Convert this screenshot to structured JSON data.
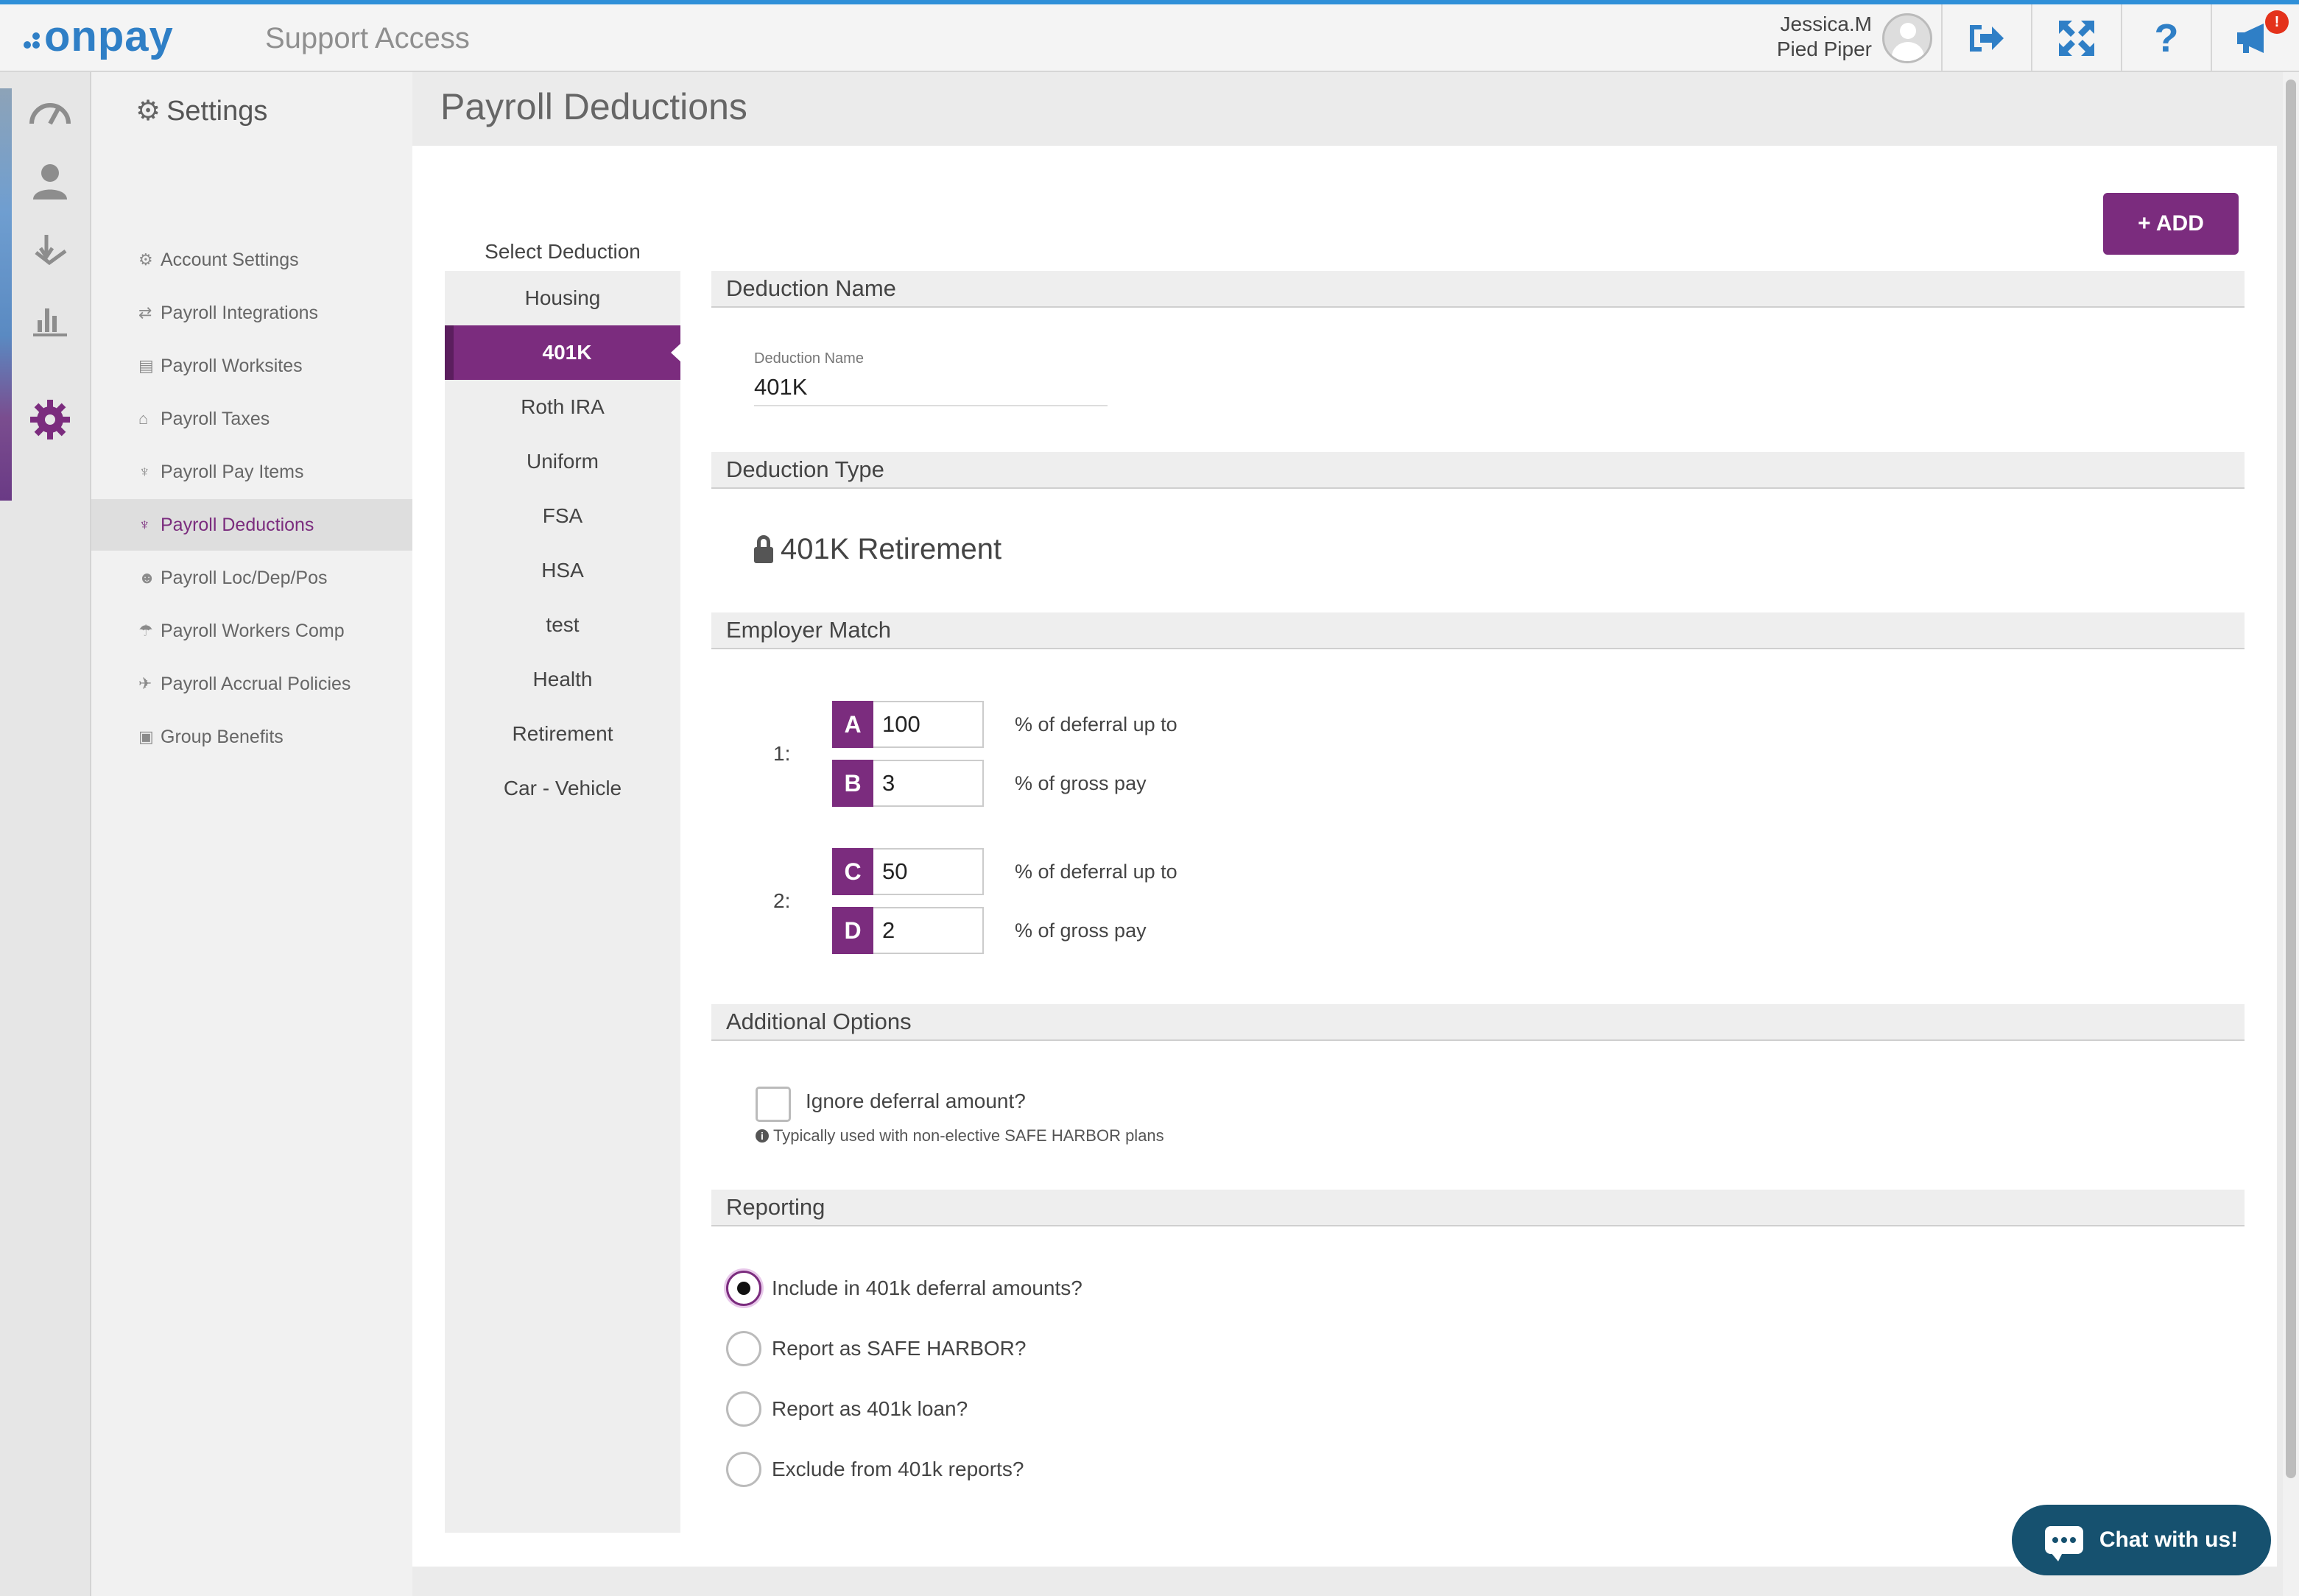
{
  "header": {
    "logo_text": "onpay",
    "subtitle": "Support Access",
    "user_name": "Jessica.M",
    "company": "Pied Piper",
    "notifications_count": "!",
    "help_glyph": "?",
    "icons": [
      "logout-icon",
      "fullscreen-icon",
      "help-icon",
      "megaphone-icon"
    ]
  },
  "rail": {
    "icons": [
      "dashboard-icon",
      "people-icon",
      "payroll-icon",
      "reports-icon",
      "settings-icon"
    ],
    "active": "settings-icon"
  },
  "settings": {
    "title": "Settings",
    "items": [
      {
        "label": "Account Settings",
        "icon": "gears-icon"
      },
      {
        "label": "Payroll Integrations",
        "icon": "exchange-icon"
      },
      {
        "label": "Payroll Worksites",
        "icon": "building-icon"
      },
      {
        "label": "Payroll Taxes",
        "icon": "bank-icon"
      },
      {
        "label": "Payroll Pay Items",
        "icon": "hand-icon"
      },
      {
        "label": "Payroll Deductions",
        "icon": "hand-icon"
      },
      {
        "label": "Payroll Loc/Dep/Pos",
        "icon": "group-icon"
      },
      {
        "label": "Payroll Workers Comp",
        "icon": "umbrella-icon"
      },
      {
        "label": "Payroll Accrual Policies",
        "icon": "plane-icon"
      },
      {
        "label": "Group Benefits",
        "icon": "medkit-icon"
      }
    ],
    "active_index": 5
  },
  "page": {
    "title": "Payroll Deductions",
    "add_label": "+ ADD"
  },
  "deductions": {
    "label": "Select Deduction",
    "items": [
      "Housing",
      "401K",
      "Roth IRA",
      "Uniform",
      "FSA",
      "HSA",
      "test",
      "Health",
      "Retirement",
      "Car - Vehicle"
    ],
    "active_index": 1
  },
  "form": {
    "name_section": "Deduction Name",
    "name_label": "Deduction Name",
    "name_value": "401K",
    "type_section": "Deduction Type",
    "type_value": "401K Retirement",
    "match_section": "Employer Match",
    "tiers": [
      {
        "num": "1:",
        "rows": [
          {
            "letter": "A",
            "value": "100",
            "text": "% of deferral up to"
          },
          {
            "letter": "B",
            "value": "3",
            "text": "% of gross pay"
          }
        ]
      },
      {
        "num": "2:",
        "rows": [
          {
            "letter": "C",
            "value": "50",
            "text": "% of deferral up to"
          },
          {
            "letter": "D",
            "value": "2",
            "text": "% of gross pay"
          }
        ]
      }
    ],
    "options_section": "Additional Options",
    "ignore_label": "Ignore deferral amount?",
    "ignore_checked": false,
    "ignore_hint": "Typically used with non-elective SAFE HARBOR plans",
    "reporting_section": "Reporting",
    "reporting_options": [
      "Include in 401k deferral amounts?",
      "Report as SAFE HARBOR?",
      "Report as 401k loan?",
      "Exclude from 401k reports?"
    ],
    "reporting_selected": 0
  },
  "chat": {
    "label": "Chat with us!"
  },
  "colors": {
    "brand": "#2f7fc6",
    "accent": "#7b2c7e",
    "chat": "#16516f"
  }
}
